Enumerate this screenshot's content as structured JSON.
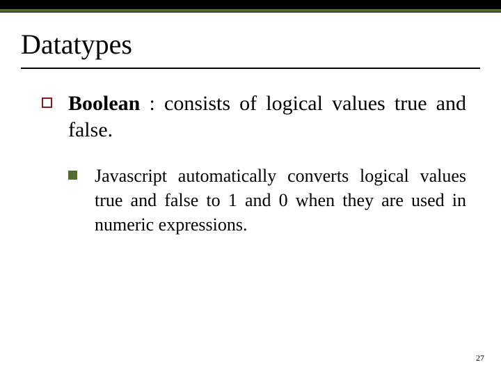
{
  "title": "Datatypes",
  "bullet1": {
    "term": "Boolean",
    "sep": " : ",
    "rest": "consists of logical values true and false."
  },
  "bullet2": {
    "pre": "Javascript automatically converts logical values ",
    "true": "true",
    "mid1": " and ",
    "false": "false",
    "mid2": " to ",
    "one": "1",
    "mid3": " and ",
    "zero": "0",
    "post": " when they are used in numeric expressions."
  },
  "pageNumber": "27"
}
